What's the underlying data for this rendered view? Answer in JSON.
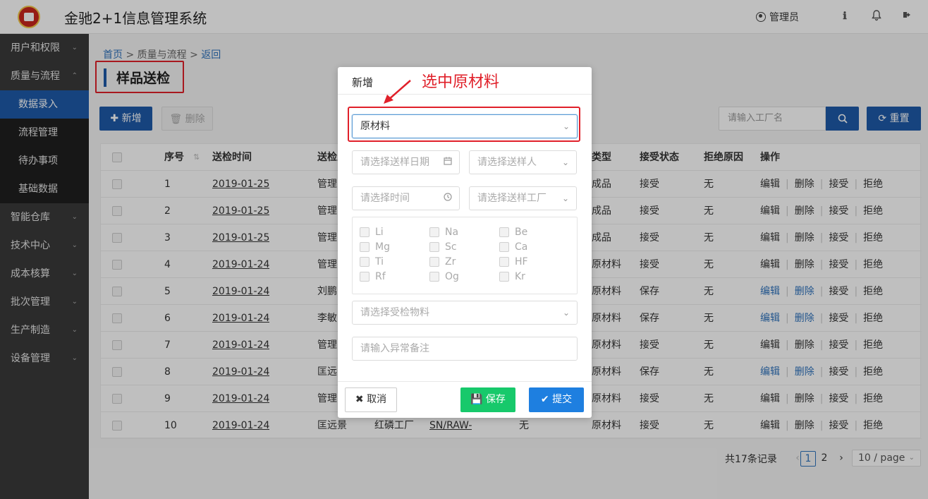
{
  "app": {
    "title": "金驰2+1信息管理系统"
  },
  "header": {
    "user_label": "管理员",
    "info_icon": "ℹ",
    "bell_icon": "bell-icon",
    "logout_icon": "logout-icon"
  },
  "sidebar": {
    "items": [
      {
        "label": "用户和权限",
        "chevron": "⌄"
      },
      {
        "label": "质量与流程",
        "chevron": "⌃"
      },
      {
        "label": "数据录入"
      },
      {
        "label": "流程管理"
      },
      {
        "label": "待办事项"
      },
      {
        "label": "基础数据"
      },
      {
        "label": "智能仓库",
        "chevron": "⌄"
      },
      {
        "label": "技术中心",
        "chevron": "⌄"
      },
      {
        "label": "成本核算",
        "chevron": "⌄"
      },
      {
        "label": "批次管理",
        "chevron": "⌄"
      },
      {
        "label": "生产制造",
        "chevron": "⌄"
      },
      {
        "label": "设备管理",
        "chevron": "⌄"
      }
    ]
  },
  "breadcrumb": {
    "home": "首页",
    "sep1": " > ",
    "section": "质量与流程",
    "sep2": " > ",
    "back": "返回"
  },
  "page": {
    "title": "样品送检"
  },
  "toolbar": {
    "add_label": "✚ 新增",
    "delete_label": "🗑 删除",
    "search_placeholder": "请输入工厂名",
    "reset_label": "⟳ 重置"
  },
  "table": {
    "headers": {
      "no": "序号",
      "time": "送检时间",
      "sender": "送检人",
      "type": "类型",
      "status": "接受状态",
      "reason": "拒绝原因",
      "ops": "操作"
    },
    "rows": [
      {
        "no": "1",
        "time": "2019-01-25",
        "sender": "管理员",
        "type": "成品",
        "status": "接受",
        "reason": "无"
      },
      {
        "no": "2",
        "time": "2019-01-25",
        "sender": "管理员",
        "type": "成品",
        "status": "接受",
        "reason": "无"
      },
      {
        "no": "3",
        "time": "2019-01-25",
        "sender": "管理员",
        "type": "成品",
        "status": "接受",
        "reason": "无"
      },
      {
        "no": "4",
        "time": "2019-01-24",
        "sender": "管理员",
        "type": "原材料",
        "status": "接受",
        "reason": "无"
      },
      {
        "no": "5",
        "time": "2019-01-24",
        "sender": "刘鹏",
        "type": "原材料",
        "status": "保存",
        "reason": "无"
      },
      {
        "no": "6",
        "time": "2019-01-24",
        "sender": "李敏",
        "type": "原材料",
        "status": "保存",
        "reason": "无"
      },
      {
        "no": "7",
        "time": "2019-01-24",
        "sender": "管理员",
        "type": "原材料",
        "status": "接受",
        "reason": "无"
      },
      {
        "no": "8",
        "time": "2019-01-24",
        "sender": "匡远",
        "type": "原材料",
        "status": "保存",
        "reason": "无"
      },
      {
        "no": "9",
        "time": "2019-01-24",
        "sender": "管理员",
        "type": "原材料",
        "status": "接受",
        "reason": "无"
      },
      {
        "no": "10",
        "time": "2019-01-24",
        "sender": "匡远景",
        "factory": "红磷工厂",
        "code": "SN/RAW-",
        "extra": "无",
        "type": "原材料",
        "status": "接受",
        "reason": "无"
      }
    ],
    "actions": {
      "edit": "编辑",
      "delete": "删除",
      "accept": "接受",
      "reject": "拒绝"
    }
  },
  "pagination": {
    "total": "共17条记录",
    "prev": "‹",
    "page1": "1",
    "page2": "2",
    "next": "›",
    "size": "10 / page"
  },
  "modal": {
    "title": "新增",
    "material_type": "原材料",
    "send_date_placeholder": "请选择送样日期",
    "sender_placeholder": "请选择送样人",
    "time_placeholder": "请选择时间",
    "factory_placeholder": "请选择送样工厂",
    "elements": [
      "Li",
      "Na",
      "Be",
      "Mg",
      "Sc",
      "Ca",
      "Ti",
      "Zr",
      "HF",
      "Rf",
      "Og",
      "Kr"
    ],
    "material_placeholder": "请选择受检物料",
    "remark_placeholder": "请输入异常备注",
    "cancel_label": "✖ 取消",
    "save_label": "💾  保存",
    "submit_label": "✔ 提交"
  },
  "annotation": {
    "text": "选中原材料"
  },
  "colors": {
    "accent": "#1e5aa8",
    "sidebar": "#3a3a3a",
    "annotation": "#e0202a",
    "save": "#17c96b",
    "submit": "#1e7fe0"
  }
}
